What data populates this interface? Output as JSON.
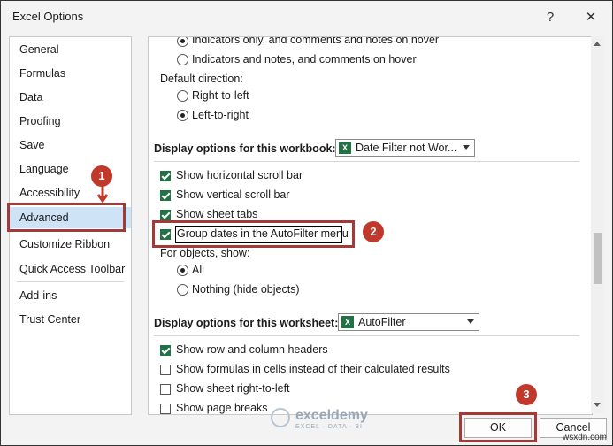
{
  "window": {
    "title": "Excel Options",
    "help": "?",
    "close": "✕"
  },
  "sidebar": {
    "items": [
      {
        "label": "General"
      },
      {
        "label": "Formulas"
      },
      {
        "label": "Data"
      },
      {
        "label": "Proofing"
      },
      {
        "label": "Save"
      },
      {
        "label": "Language"
      },
      {
        "label": "Accessibility"
      },
      {
        "label": "Advanced"
      },
      {
        "label": "Customize Ribbon"
      },
      {
        "label": "Quick Access Toolbar"
      },
      {
        "label": "Add-ins"
      },
      {
        "label": "Trust Center"
      }
    ],
    "selected": "Advanced"
  },
  "content": {
    "comments_opt1": "Indicators only, and comments and notes on hover",
    "comments_opt2": "Indicators and notes, and comments on hover",
    "default_direction_label": "Default direction:",
    "dir_rtl": "Right-to-left",
    "dir_ltr": "Left-to-right",
    "workbook_section": "Display options for this workbook:",
    "workbook_dropdown": "Date Filter not Wor...",
    "workbook_icon": "excel-icon",
    "wb_horizontal_scroll": "Show horizontal scroll bar",
    "wb_vertical_scroll": "Show vertical scroll bar",
    "wb_sheet_tabs": "Show sheet tabs",
    "wb_group_dates": "Group dates in the AutoFilter menu",
    "for_objects_label": "For objects, show:",
    "objects_all": "All",
    "objects_nothing": "Nothing (hide objects)",
    "worksheet_section": "Display options for this worksheet:",
    "worksheet_dropdown": "AutoFilter",
    "ws_headers": "Show row and column headers",
    "ws_formulas": "Show formulas in cells instead of their calculated results",
    "ws_rtl": "Show sheet right-to-left",
    "ws_page_breaks": "Show page breaks"
  },
  "buttons": {
    "ok": "OK",
    "cancel": "Cancel"
  },
  "annotations": {
    "n1": "1",
    "n2": "2",
    "n3": "3"
  },
  "watermark": {
    "brand": "exceldemy",
    "tagline": "EXCEL · DATA · BI"
  },
  "site_mark": "wsxdn.com",
  "colors": {
    "annotation": "#c0392b",
    "checkbox": "#217346",
    "selection": "#cfe3f6"
  }
}
